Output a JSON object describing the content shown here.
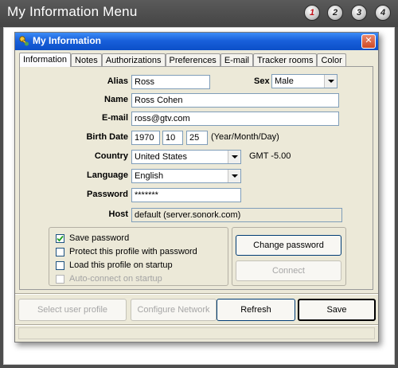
{
  "header": {
    "title": "My Information Menu",
    "steps": [
      "1",
      "2",
      "3",
      "4"
    ]
  },
  "dialog": {
    "title": "My Information",
    "close_glyph": "✕",
    "tabs": [
      "Information",
      "Notes",
      "Authorizations",
      "Preferences",
      "E-mail",
      "Tracker rooms",
      "Color"
    ],
    "fields": {
      "alias_label": "Alias",
      "alias_value": "Ross",
      "sex_label": "Sex",
      "sex_value": "Male",
      "name_label": "Name",
      "name_value": "Ross Cohen",
      "email_label": "E-mail",
      "email_value": "ross@gtv.com",
      "birth_label": "Birth Date",
      "birth_year": "1970",
      "birth_month": "10",
      "birth_day": "25",
      "birth_hint": "(Year/Month/Day)",
      "country_label": "Country",
      "country_value": "United States",
      "gmt": "GMT -5.00",
      "language_label": "Language",
      "language_value": "English",
      "password_label": "Password",
      "password_value": "*******",
      "host_label": "Host",
      "host_value": "default (server.sonork.com)"
    },
    "options": {
      "save_password": "Save password",
      "protect_profile": "Protect this profile with password",
      "load_on_startup": "Load this profile on startup",
      "auto_connect": "Auto-connect on startup"
    },
    "option_states": {
      "save_password": true,
      "protect_profile": false,
      "load_on_startup": false,
      "auto_connect": false
    },
    "buttons": {
      "change_password": "Change password",
      "connect": "Connect",
      "select_user_profile": "Select user profile",
      "configure_network": "Configure Network",
      "refresh": "Refresh",
      "save": "Save"
    }
  },
  "icons": {
    "app": "key-person-icon",
    "close": "close-icon",
    "dropdown": "chevron-down-icon",
    "check": "checkmark-icon"
  },
  "colors": {
    "titlebar": "#0b4fc8",
    "dialog_bg": "#ece9d8",
    "active_step": "#c01018",
    "close_button": "#cf4a26"
  }
}
